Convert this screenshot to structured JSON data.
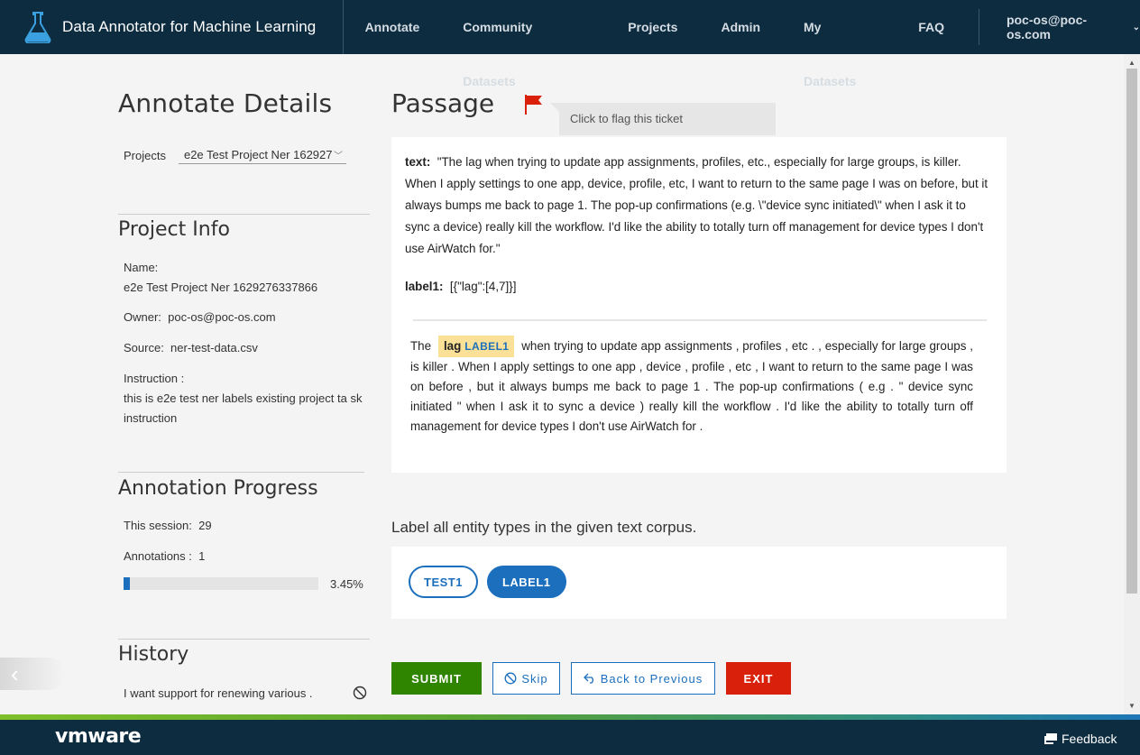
{
  "header": {
    "app_title": "Data Annotator for Machine Learning",
    "nav": [
      "Annotate",
      "Community Datasets",
      "Projects",
      "Admin",
      "My Datasets",
      "FAQ"
    ],
    "user": "poc-os@poc-os.com"
  },
  "left": {
    "title": "Annotate Details",
    "projects_label": "Projects",
    "projects_value": "e2e Test Project Ner 162927",
    "project_info_title": "Project Info",
    "name_label": "Name:",
    "name_value": "e2e Test Project Ner 1629276337866",
    "owner_label": "Owner:",
    "owner_value": "poc-os@poc-os.com",
    "source_label": "Source:",
    "source_value": "ner-test-data.csv",
    "instruction_label": "Instruction :",
    "instruction_value": "this is e2e test ner labels existing project ta sk instruction",
    "progress_title": "Annotation Progress",
    "session_label": "This session:",
    "session_value": "29",
    "annotations_label": "Annotations :",
    "annotations_value": "1",
    "progress_fraction": 0.0345,
    "progress_pct": "3.45%",
    "history_title": "History",
    "history_item": "I want support for renewing various ."
  },
  "main": {
    "passage_title": "Passage",
    "flag_tooltip": "Click to flag this ticket",
    "text_key": "text:",
    "text_value": "\"The lag when trying to update app assignments, profiles, etc., especially for large groups, is killer. When I apply settings to one app, device, profile, etc, I want to return to the same page I was on before, but it always bumps me back to page 1. The pop-up confirmations (e.g. \\\"device sync initiated\\\" when I ask it to sync a device) really kill the workflow. I'd like the ability to totally turn off management for device types I don't use AirWatch for.\"",
    "label_key": "label1:",
    "label_value": "[{\"lag\":[4,7]}]",
    "token_before": "The",
    "entity_word": "lag",
    "entity_label": "LABEL1",
    "token_after": "when trying to update app assignments , profiles , etc . , especially for large groups , is killer .   When I apply settings to one app , device , profile , etc , I want to return to the same page I was on before , but it always bumps me back to page 1 .   The pop-up confirmations ( e.g . \" device sync initiated \" when I ask it to sync a device ) really kill the workflow .   I'd like the ability to totally turn off management for device types I don't use AirWatch for .",
    "instruction": "Label all entity types in the given text corpus.",
    "labels": [
      "TEST1",
      "LABEL1"
    ],
    "buttons": {
      "submit": "SUBMIT",
      "skip": "Skip",
      "previous": "Back to Previous",
      "exit": "EXIT"
    }
  },
  "footer": {
    "brand": "vmware",
    "feedback": "Feedback"
  },
  "colors": {
    "header_bg": "#0d2c40",
    "accent_blue": "#1b6fbd",
    "submit_green": "#2f8400",
    "exit_red": "#d9200b",
    "entity_highlight": "#fbe198"
  }
}
